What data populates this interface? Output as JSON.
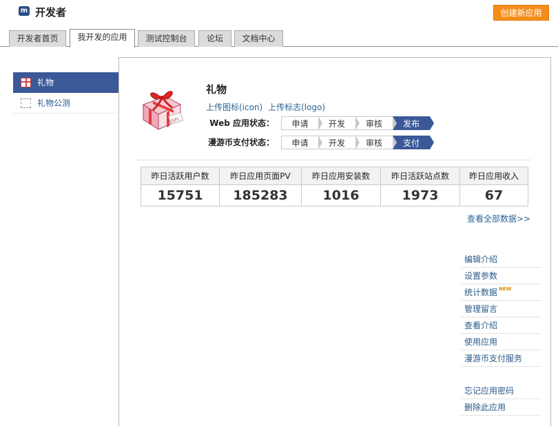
{
  "header": {
    "logo_letter": "m",
    "title": "开发者",
    "create_button": "创建新应用"
  },
  "tabs": [
    {
      "label": "开发者首页",
      "active": false
    },
    {
      "label": "我开发的应用",
      "active": true
    },
    {
      "label": "测试控制台",
      "active": false
    },
    {
      "label": "论坛",
      "active": false
    },
    {
      "label": "文档中心",
      "active": false
    }
  ],
  "sidebar": {
    "items": [
      {
        "label": "礼物",
        "active": true
      },
      {
        "label": "礼物公测",
        "active": false
      }
    ]
  },
  "app": {
    "name": "礼物",
    "upload_icon": "上传图标(icon)",
    "upload_logo": "上传标志(logo)",
    "gift_tag_text": "GiFt"
  },
  "status": {
    "web": {
      "label": "Web 应用状态：",
      "steps": [
        "申请",
        "开发",
        "审核",
        "发布"
      ],
      "current": "发布"
    },
    "payment": {
      "label": "漫游币支付状态：",
      "steps": [
        "申请",
        "开发",
        "审核",
        "支付"
      ],
      "current": "支付"
    }
  },
  "stats": [
    {
      "label": "昨日活跃用户数",
      "value": "15751"
    },
    {
      "label": "昨日应用页面PV",
      "value": "185283"
    },
    {
      "label": "昨日应用安装数",
      "value": "1016"
    },
    {
      "label": "昨日活跃站点数",
      "value": "1973"
    },
    {
      "label": "昨日应用收入",
      "value": "67"
    }
  ],
  "view_all": "查看全部数据>>",
  "actions": [
    {
      "label": "编辑介绍"
    },
    {
      "label": "设置参数"
    },
    {
      "label": "统计数据",
      "badge": "NEW"
    },
    {
      "label": "管理留言"
    },
    {
      "label": "查看介绍"
    },
    {
      "label": "使用应用"
    },
    {
      "label": "漫游币支付服务"
    }
  ],
  "actions_secondary": [
    {
      "label": "忘记应用密码"
    },
    {
      "label": "删除此应用"
    }
  ],
  "colors": {
    "brand_blue": "#3b5998",
    "create_orange": "#f58d1b",
    "link_blue": "#2a6496"
  }
}
